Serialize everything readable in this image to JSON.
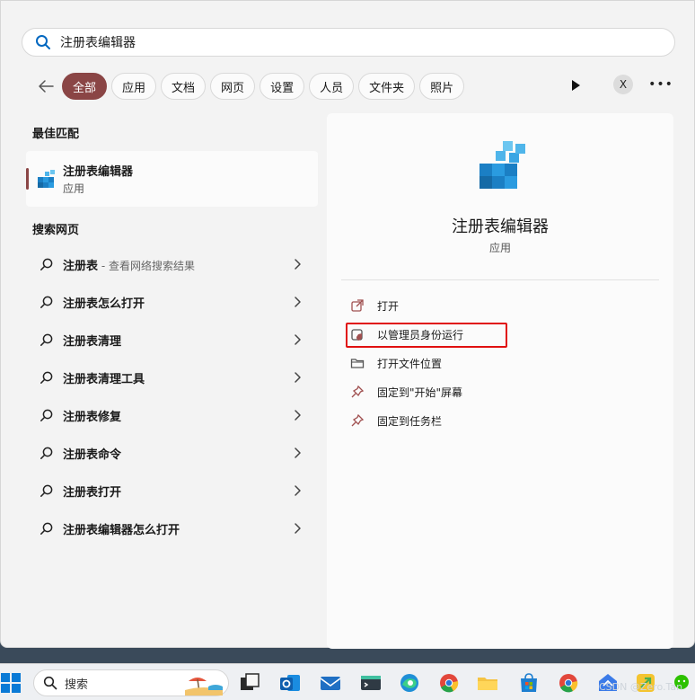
{
  "search": {
    "value": "注册表编辑器"
  },
  "filters": [
    "全部",
    "应用",
    "文档",
    "网页",
    "设置",
    "人员",
    "文件夹",
    "照片"
  ],
  "account_initial": "X",
  "best_match": {
    "section_title": "最佳匹配",
    "name": "注册表编辑器",
    "type": "应用"
  },
  "web": {
    "section_title": "搜索网页",
    "items": [
      {
        "bold": "注册表",
        "hint": " - 查看网络搜索结果"
      },
      {
        "bold": "注册表怎么打开",
        "hint": ""
      },
      {
        "bold": "注册表清理",
        "hint": ""
      },
      {
        "bold": "注册表清理工具",
        "hint": ""
      },
      {
        "bold": "注册表修复",
        "hint": ""
      },
      {
        "bold": "注册表命令",
        "hint": ""
      },
      {
        "bold": "注册表打开",
        "hint": ""
      },
      {
        "bold": "注册表编辑器怎么打开",
        "hint": ""
      }
    ]
  },
  "detail": {
    "title": "注册表编辑器",
    "subtitle": "应用",
    "actions": [
      {
        "label": "打开",
        "icon": "open-external-icon"
      },
      {
        "label": "以管理员身份运行",
        "icon": "shield-admin-icon"
      },
      {
        "label": "打开文件位置",
        "icon": "folder-icon"
      },
      {
        "label": "固定到\"开始\"屏幕",
        "icon": "pin-icon"
      },
      {
        "label": "固定到任务栏",
        "icon": "pin-icon"
      }
    ]
  },
  "taskbar": {
    "search_label": "搜索"
  },
  "watermark": "CSDN @Zero.Tan",
  "colors": {
    "accent": "#8a4545",
    "highlight": "#e01010"
  }
}
